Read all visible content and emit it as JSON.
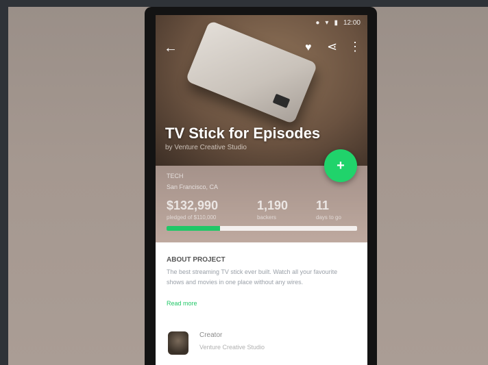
{
  "status_bar": {
    "time": "12:00"
  },
  "hero": {
    "title": "TV Stick for Episodes",
    "subtitle": "by Venture Creative Studio"
  },
  "fab": {
    "label": "+"
  },
  "funding": {
    "category": "TECH",
    "location": "San Francisco, CA",
    "pledged": "$132,990",
    "pledged_label": "pledged of $110,000",
    "backers": "1,190",
    "backers_label": "backers",
    "days": "11",
    "days_label": "days to go",
    "progress_percent": 28
  },
  "about": {
    "title": "ABOUT PROJECT",
    "text": "The best streaming TV stick ever built. Watch all your favourite shows and movies in one place without any wires.",
    "read_more": "Read more"
  },
  "creator": {
    "name": "Creator",
    "subtitle": "Venture Creative Studio"
  },
  "colors": {
    "accent": "#21c767",
    "fab": "#20d36b"
  }
}
